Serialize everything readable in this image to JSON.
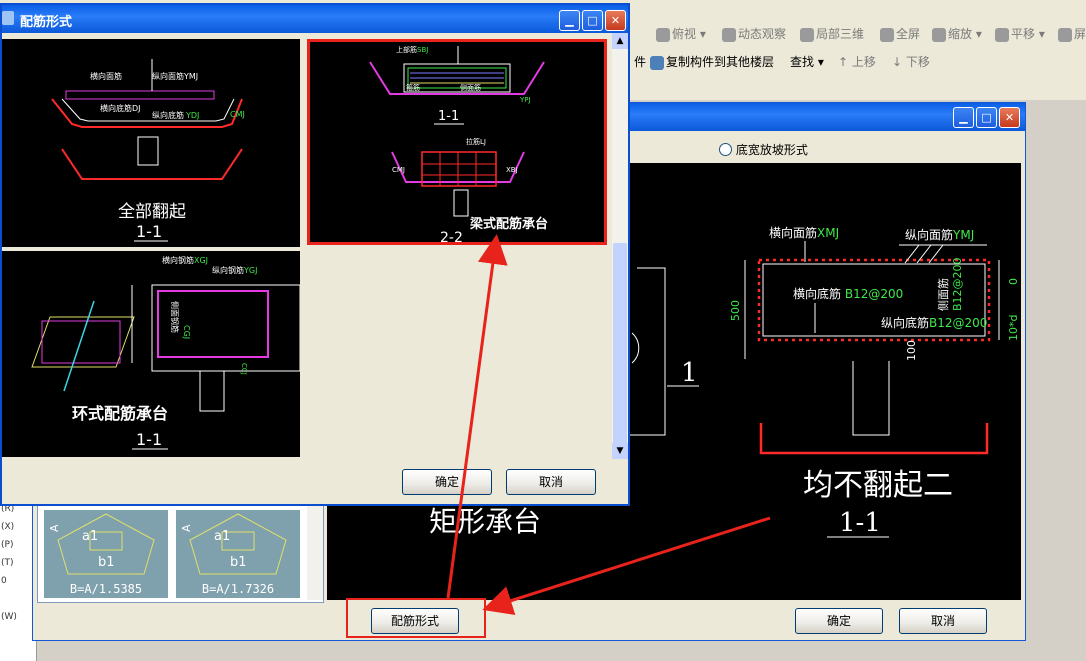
{
  "toolbar": {
    "row1": [
      {
        "icon": "view-icon",
        "label": "俯视"
      },
      {
        "icon": "orbit-icon",
        "label": "动态观察"
      },
      {
        "icon": "local-3d-icon",
        "label": "局部三维"
      },
      {
        "icon": "fullscreen-icon",
        "label": "全屏"
      },
      {
        "icon": "zoom-icon",
        "label": "缩放"
      },
      {
        "icon": "pan-icon",
        "label": "平移"
      },
      {
        "icon": "more-icon",
        "label": "屏"
      }
    ],
    "row2_left": "件",
    "copy_label": "复制构件到其他楼层",
    "find_label": "查找",
    "up_label": "上移",
    "down_label": "下移"
  },
  "left_shortcuts": [
    "(R)",
    "(X)",
    "(P)",
    "(T)",
    "0",
    "",
    "(W)"
  ],
  "back_window": {
    "radio_label": "底宽放坡形式",
    "ok_label": "确定",
    "cancel_label": "取消",
    "rebar_button_label": "配筋形式",
    "thumbs": [
      {
        "a": "A",
        "a1": "a1",
        "b1": "b1",
        "formula": "B=A/1.5385"
      },
      {
        "a": "A",
        "a1": "a1",
        "b1": "b1",
        "formula": "B=A/1.7326"
      }
    ],
    "left_drawing": {
      "caption": "矩形承台",
      "section": "1"
    },
    "drawing": {
      "title": "均不翻起二",
      "section": "1-1",
      "labels": {
        "transverse_top": "横向面筋",
        "transverse_top_code": "XMJ",
        "longitudinal_top": "纵向面筋",
        "longitudinal_top_code": "YMJ",
        "transverse_bottom": "横向底筋",
        "transverse_bottom_val": "B12@200",
        "longitudinal_bottom": "纵向底筋",
        "longitudinal_bottom_val": "B12@200",
        "side": "侧面筋",
        "side_val": "B12@200",
        "dim_500": "500",
        "dim_100": "100",
        "dim_0": "0",
        "dim_10d": "10*d"
      }
    }
  },
  "front_window": {
    "title": "配筋形式",
    "ok_label": "确定",
    "cancel_label": "取消",
    "cells": [
      {
        "caption": "全部翻起",
        "section": "1-1",
        "labels": {
          "top_transverse": "横向面筋",
          "top_longitudinal": "纵向面筋YMJ",
          "bottom_transverse": "横向底筋DJ",
          "bottom_longitudinal": "纵向底筋",
          "code": "YDJ",
          "side": "CMJ"
        }
      },
      {
        "caption": "梁式配筋承台",
        "section_top": "1-1",
        "section_bottom": "2-2",
        "labels": {
          "top_rebar": "上部筋",
          "top_code": "SBJ",
          "stirrup": "箍筋",
          "side": "侧面筋",
          "side_code": "CMJ",
          "bottom": "下部筋",
          "bottom_code": "XBJ",
          "lj": "拉筋LJ",
          "ypj": "YPJ"
        }
      },
      {
        "caption": "环式配筋承台",
        "section": "1-1",
        "labels": {
          "transverse": "横向钢筋",
          "transverse_code": "XGJ",
          "longitudinal": "纵向钢筋",
          "longitudinal_code": "YGJ",
          "side": "侧面钢筋",
          "side_code": "CGJ",
          "side2": "CCJ"
        }
      }
    ],
    "selected_index": 1
  },
  "colors": {
    "selection_red": "#e8231b",
    "rebar_red": "#ff2a2a",
    "label_green": "#3ee84a",
    "magenta": "#e23be2",
    "titlebar_blue": "#0a5fe6"
  }
}
